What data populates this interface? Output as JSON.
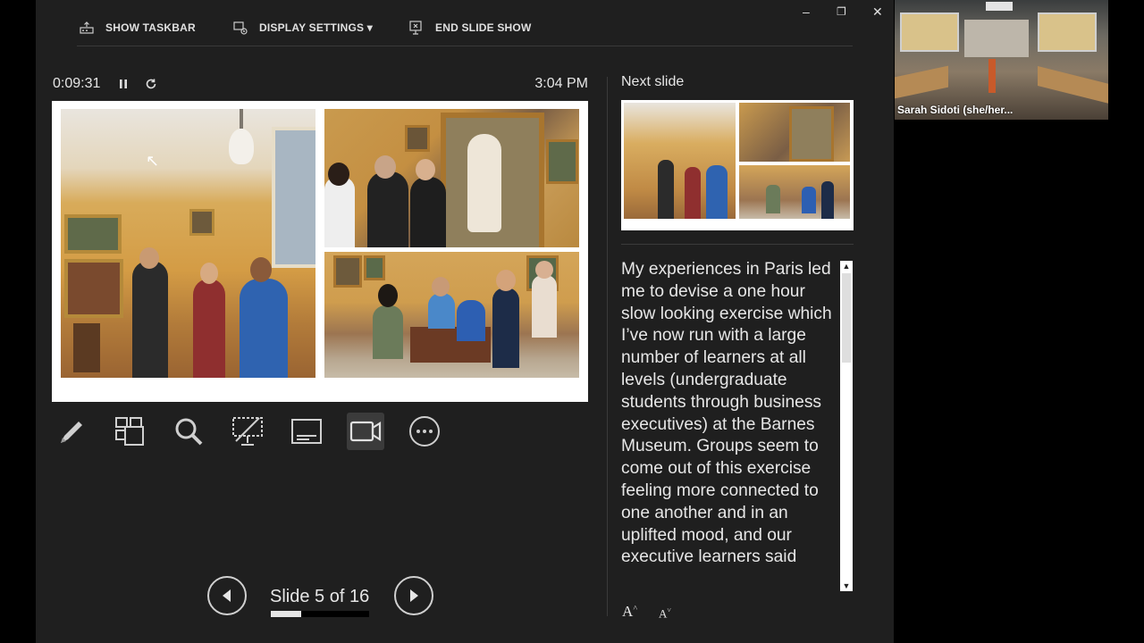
{
  "top_bar": {
    "show_taskbar": "SHOW TASKBAR",
    "display_settings": "DISPLAY SETTINGS ▾",
    "end_slide_show": "END SLIDE SHOW"
  },
  "window_controls": {
    "minimize": "–",
    "restore": "❐",
    "close": "✕"
  },
  "timer": {
    "elapsed": "0:09:31",
    "clock": "3:04 PM"
  },
  "current_slide": {
    "image_count": 3
  },
  "tools": [
    "pen-tool",
    "see-all-slides",
    "zoom",
    "black-screen",
    "subtitles",
    "camera",
    "more-options"
  ],
  "navigation": {
    "counter": "Slide 5 of 16",
    "progress_fraction": 0.3125
  },
  "next_slide": {
    "label": "Next slide"
  },
  "notes": {
    "text": "My experiences in Paris led me to devise a one hour slow looking exercise which I’ve now run with a large number of learners at all levels (undergraduate students through business executives) at the Barnes Museum. Groups seem to come out of this exercise feeling more connected to one another and in an uplifted mood, and our executive learners said"
  },
  "font_controls": {
    "increase": "A",
    "decrease": "A"
  },
  "video": {
    "participant_name": "Sarah Sidoti (she/her..."
  }
}
